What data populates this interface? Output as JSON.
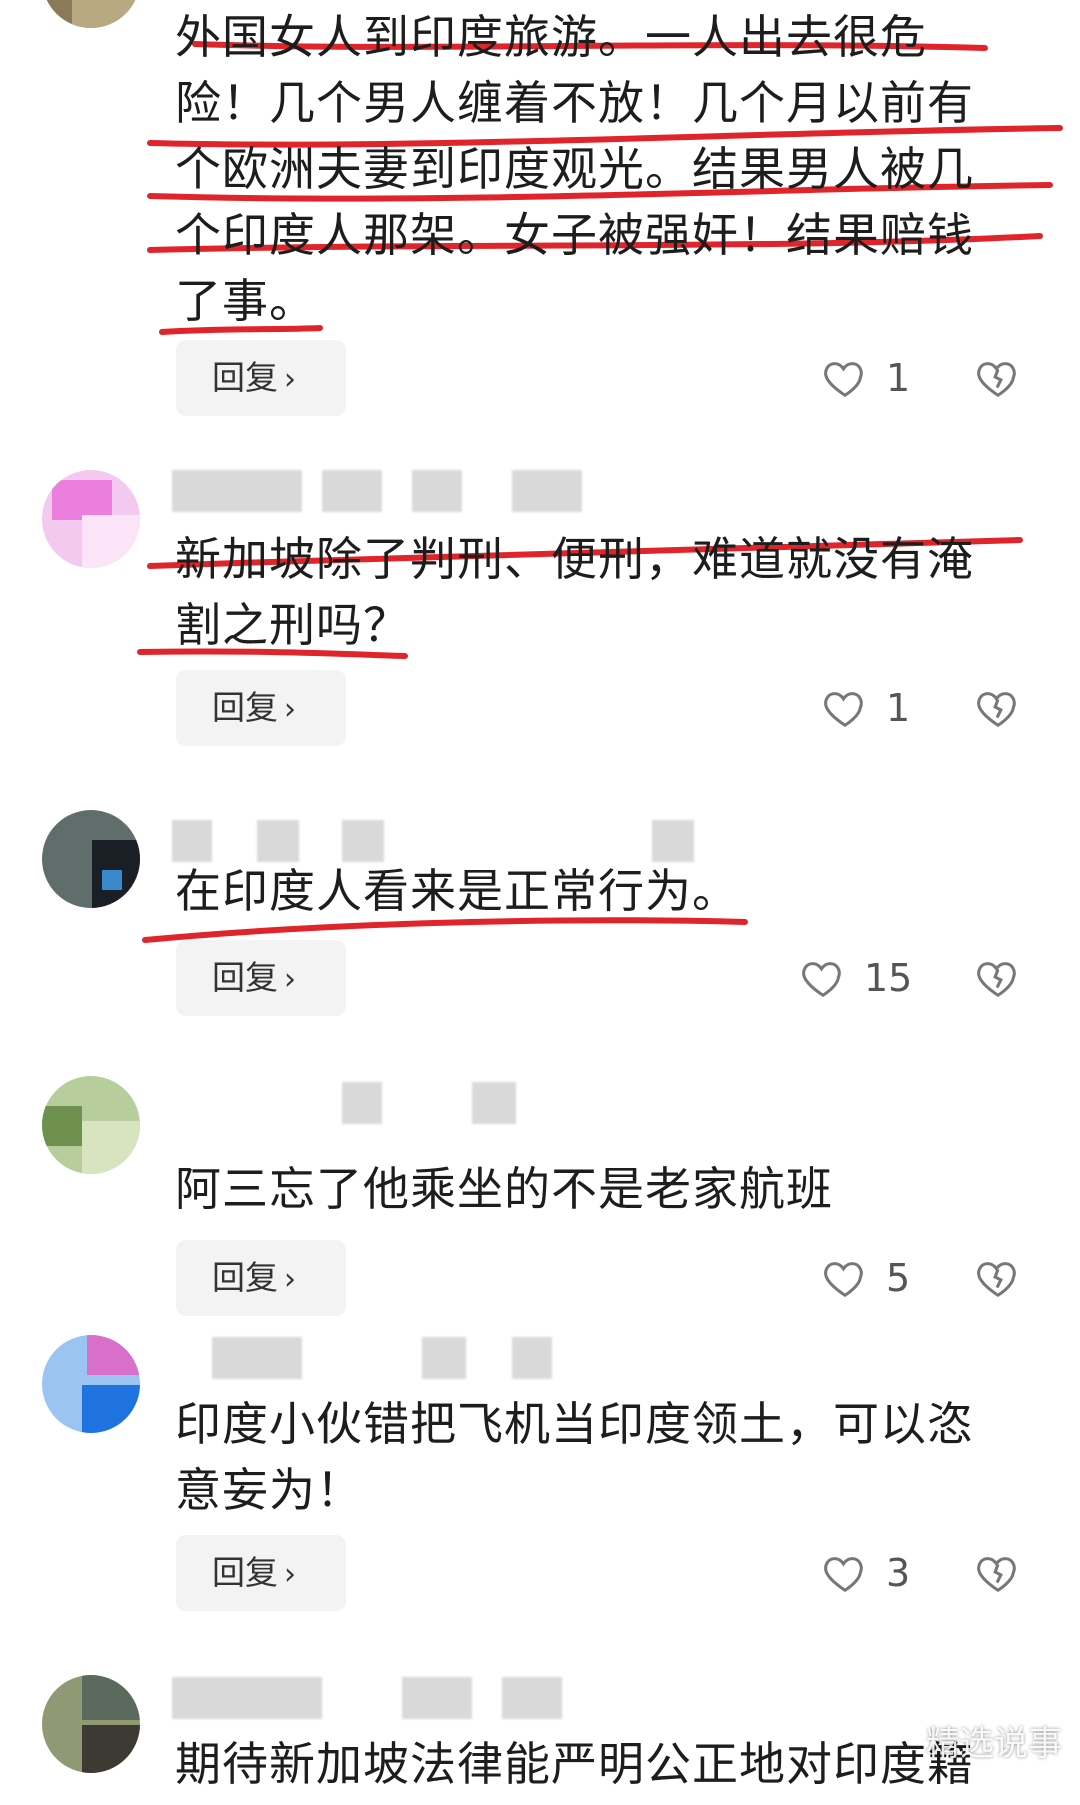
{
  "comments": [
    {
      "text_lines": [
        "外国女人到印度旅游。一人出去很危",
        "险！几个男人缠着不放！几个月以前有",
        "个欧洲夫妻到印度观光。结果男人被几",
        "个印度人那架。女子被强奸！结果赔钱",
        "了事。"
      ],
      "reply_label": "回复",
      "likes": "1"
    },
    {
      "text_lines": [
        "新加坡除了判刑、便刑，难道就没有淹",
        "割之刑吗？"
      ],
      "reply_label": "回复",
      "likes": "1"
    },
    {
      "text_lines": [
        "在印度人看来是正常行为。"
      ],
      "reply_label": "回复",
      "likes": "15"
    },
    {
      "text_lines": [
        "阿三忘了他乘坐的不是老家航班"
      ],
      "reply_label": "回复",
      "likes": "5"
    },
    {
      "text_lines": [
        "印度小伙错把飞机当印度领土，可以恣",
        "意妄为！"
      ],
      "reply_label": "回复",
      "likes": "3"
    },
    {
      "text_lines": [
        "期待新加坡法律能严明公正地对印度籍"
      ]
    }
  ],
  "watermark": "精选说事",
  "colors": {
    "underline": "#e0242b",
    "reply_bg": "#f3f3f3",
    "text": "#1d1d1d"
  },
  "icons": {
    "like": "heart-outline-icon",
    "dislike": "broken-heart-icon",
    "chevron": "chevron-right-icon"
  }
}
